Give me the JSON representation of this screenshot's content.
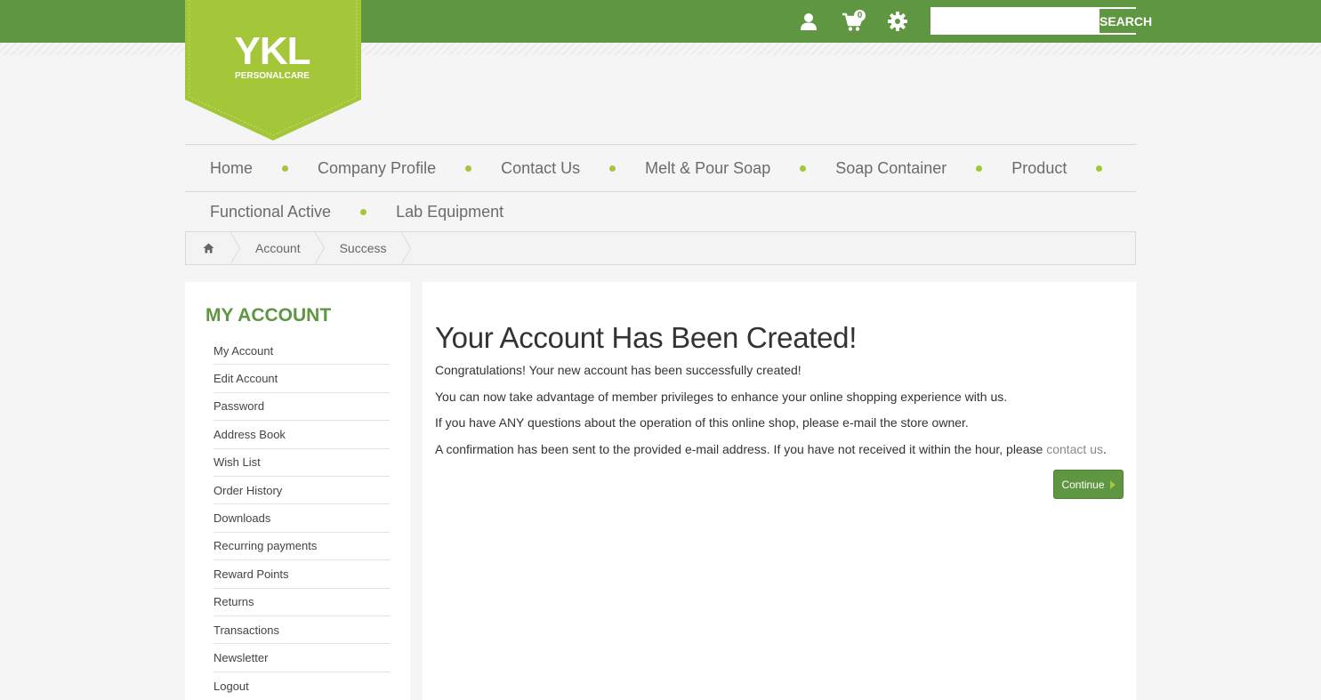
{
  "header": {
    "logo": {
      "main": "YKL",
      "sub": "PERSONALCARE"
    },
    "icons": [
      "user-icon",
      "cart-icon",
      "gear-icon"
    ],
    "cart_count": "0",
    "search": {
      "placeholder": "",
      "button_label": "SEARCH"
    }
  },
  "nav": {
    "row1": [
      "Home",
      "Company Profile",
      "Contact Us",
      "Melt & Pour Soap",
      "Soap Container",
      "Product"
    ],
    "row2": [
      "Functional Active",
      "Lab Equipment"
    ]
  },
  "breadcrumb": {
    "home_icon": "home-icon",
    "items": [
      "Account",
      "Success"
    ]
  },
  "sidebar": {
    "title": "MY ACCOUNT",
    "items": [
      "My Account",
      "Edit Account",
      "Password",
      "Address Book",
      "Wish List",
      "Order History",
      "Downloads",
      "Recurring payments",
      "Reward Points",
      "Returns",
      "Transactions",
      "Newsletter",
      "Logout"
    ]
  },
  "content": {
    "title": "Your Account Has Been Created!",
    "p1": "Congratulations! Your new account has been successfully created!",
    "p2": "You can now take advantage of member privileges to enhance your online shopping experience with us.",
    "p3": "If you have ANY questions about the operation of this online shop, please e-mail the store owner.",
    "p4_text": "A confirmation has been sent to the provided e-mail address. If you have not received it within the hour, please ",
    "p4_link": "contact us",
    "p4_end": ".",
    "continue_label": "Continue"
  },
  "colors": {
    "brand_green": "#5e9641",
    "accent_lime": "#a4c639"
  }
}
